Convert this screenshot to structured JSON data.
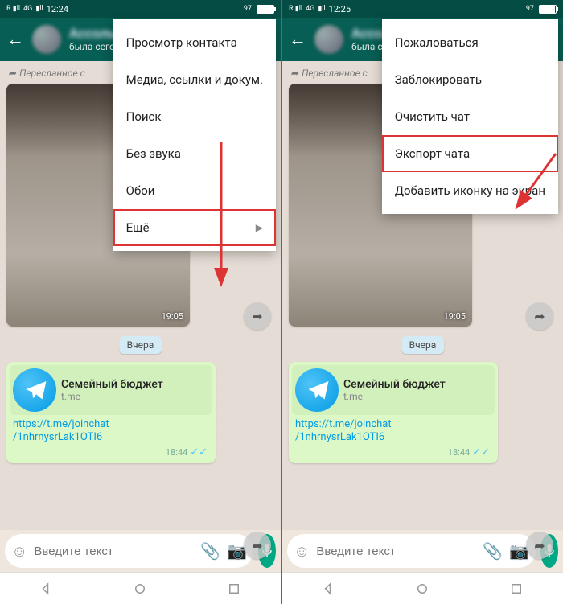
{
  "left": {
    "status": {
      "time": "12:24",
      "signal": "4G",
      "battery_pct": "97"
    },
    "contact": {
      "name": "Ассоль",
      "status": "была сегодн"
    },
    "forwarded_label": "Пересланное с",
    "image_time": "19:05",
    "date_chip": "Вчера",
    "link": {
      "title": "Семейный бюджет",
      "domain": "t.me",
      "url_l1": "https://t.me/joinchat",
      "url_l2": "/1nhrnysrLak1OTI6",
      "time": "18:44"
    },
    "input_placeholder": "Введите текст",
    "menu": {
      "items": [
        {
          "label": "Просмотр контакта",
          "hi": false
        },
        {
          "label": "Медиа, ссылки и докум.",
          "hi": false
        },
        {
          "label": "Поиск",
          "hi": false
        },
        {
          "label": "Без звука",
          "hi": false
        },
        {
          "label": "Обои",
          "hi": false
        },
        {
          "label": "Ещё",
          "hi": true,
          "more": true
        }
      ]
    }
  },
  "right": {
    "status": {
      "time": "12:25",
      "signal": "4G",
      "battery_pct": "97"
    },
    "contact": {
      "name": "Ассоль",
      "status": "была сегодн"
    },
    "forwarded_label": "Пересланное с",
    "image_time": "19:05",
    "date_chip": "Вчера",
    "link": {
      "title": "Семейный бюджет",
      "domain": "t.me",
      "url_l1": "https://t.me/joinchat",
      "url_l2": "/1nhrnysrLak1OTI6",
      "time": "18:44"
    },
    "input_placeholder": "Введите текст",
    "menu": {
      "items": [
        {
          "label": "Пожаловаться",
          "hi": false
        },
        {
          "label": "Заблокировать",
          "hi": false
        },
        {
          "label": "Очистить чат",
          "hi": false
        },
        {
          "label": "Экспорт чата",
          "hi": true
        },
        {
          "label": "Добавить иконку на экран",
          "hi": false
        }
      ]
    }
  }
}
